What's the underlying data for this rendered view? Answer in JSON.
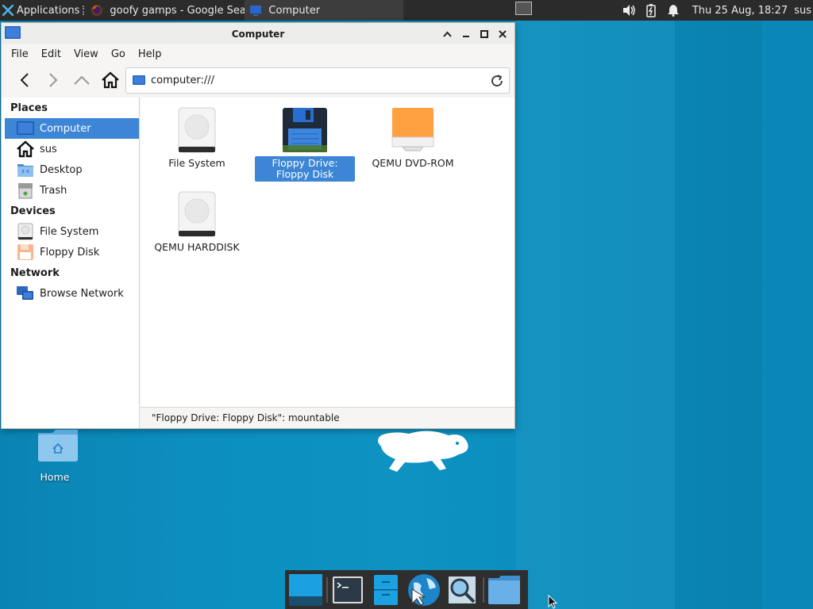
{
  "top_panel": {
    "applications_label": "Applications",
    "tasks": [
      {
        "label": "goofy gamps - Google Sea...",
        "icon": "firefox-icon"
      },
      {
        "label": "Computer",
        "icon": "computer-icon"
      }
    ],
    "clock": "Thu 25 Aug, 18:27",
    "user": "sus"
  },
  "window": {
    "title": "Computer",
    "menu": [
      "File",
      "Edit",
      "View",
      "Go",
      "Help"
    ],
    "location": "computer:///",
    "sidebar": {
      "places_header": "Places",
      "places": [
        "Computer",
        "sus",
        "Desktop",
        "Trash"
      ],
      "devices_header": "Devices",
      "devices": [
        "File System",
        "Floppy Disk"
      ],
      "network_header": "Network",
      "network": [
        "Browse Network"
      ]
    },
    "items": [
      {
        "label": "File System",
        "icon": "harddisk-icon"
      },
      {
        "label": "Floppy Drive: Floppy Disk",
        "icon": "floppy-icon",
        "selected": true
      },
      {
        "label": "QEMU DVD-ROM",
        "icon": "optical-drive-icon"
      },
      {
        "label": "QEMU HARDDISK",
        "icon": "harddisk-icon"
      }
    ],
    "status": "\"Floppy Drive: Floppy Disk\": mountable"
  },
  "desktop": {
    "home_label": "Home"
  },
  "colors": {
    "panel": "#2b2b2b",
    "selection": "#3d86d6",
    "desktop": "#0c8fbf"
  }
}
